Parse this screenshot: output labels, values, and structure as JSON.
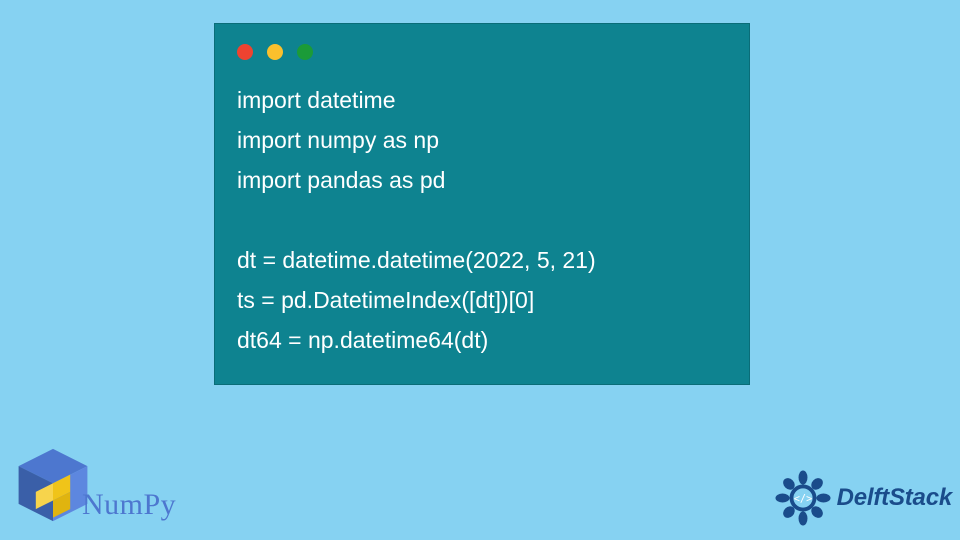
{
  "card": {
    "traffic_colors": {
      "red": "#ee4330",
      "yellow": "#fbc02d",
      "green": "#1b9b38"
    },
    "bg": "#0e8390"
  },
  "code": {
    "lines": [
      "import datetime",
      "import numpy as np",
      "import pandas as pd",
      "",
      "dt = datetime.datetime(2022, 5, 21)",
      "ts = pd.DatetimeIndex([dt])[0]",
      "dt64 = np.datetime64(dt)"
    ]
  },
  "logos": {
    "numpy": {
      "label": "NumPy",
      "color": "#4d77cf"
    },
    "delftstack": {
      "label": "DelftStack",
      "color": "#1a4c8b"
    }
  },
  "page_bg": "#86d2f2"
}
